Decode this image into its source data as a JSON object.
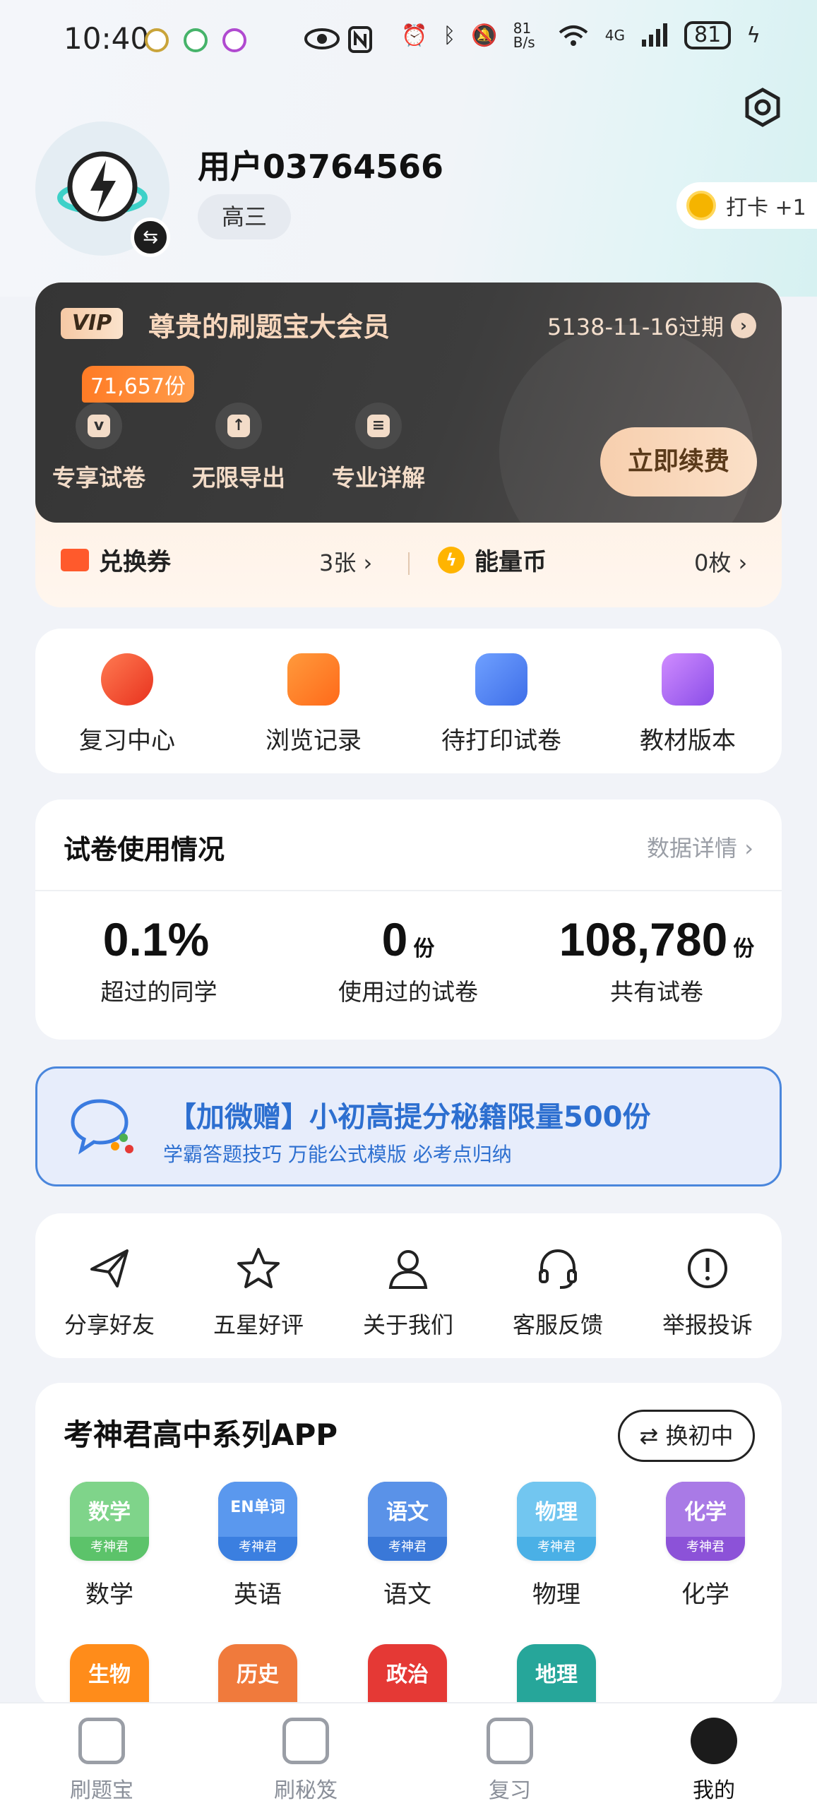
{
  "status_bar": {
    "time": "10:40",
    "net_speed": "81 B/s",
    "network": "4G",
    "battery": "81"
  },
  "profile": {
    "username": "用户03764566",
    "grade": "高三",
    "checkin": "打卡 +1"
  },
  "vip": {
    "badge": "VIP",
    "title": "尊贵的刷题宝大会员",
    "expire": "5138-11-16过期",
    "count": "71,657份",
    "features": [
      "专享试卷",
      "无限导出",
      "专业详解"
    ],
    "renew_button": "立即续费",
    "voucher_label": "兑换券",
    "voucher_value": "3张 ›",
    "coin_label": "能量币",
    "coin_value": "0枚 ›"
  },
  "tools": [
    "复习中心",
    "浏览记录",
    "待打印试卷",
    "教材版本"
  ],
  "usage": {
    "title": "试卷使用情况",
    "link": "数据详情 ›",
    "stats": [
      {
        "value": "0.1%",
        "unit": "",
        "label": "超过的同学"
      },
      {
        "value": "0",
        "unit": "份",
        "label": "使用过的试卷"
      },
      {
        "value": "108,780",
        "unit": "份",
        "label": "共有试卷"
      }
    ]
  },
  "banner": {
    "title": "【加微赠】小初高提分秘籍限量500份",
    "subtitle": "学霸答题技巧 万能公式模版 必考点归纳"
  },
  "misc": [
    "分享好友",
    "五星好评",
    "关于我们",
    "客服反馈",
    "举报投诉"
  ],
  "apps": {
    "title": "考神君高中系列APP",
    "switch_button": "⇄ 换初中",
    "brand": "考神君",
    "items": [
      {
        "label": "数学",
        "icon_text": "数学",
        "color": "#5cc36a"
      },
      {
        "label": "英语",
        "icon_text": "EN单词",
        "color": "#3b7fe0"
      },
      {
        "label": "语文",
        "icon_text": "语文",
        "color": "#3a78d8"
      },
      {
        "label": "物理",
        "icon_text": "物理",
        "color": "#4ab0e6"
      },
      {
        "label": "化学",
        "icon_text": "化学",
        "color": "#8c52d8"
      }
    ],
    "row2": [
      {
        "icon_text": "生物",
        "color": "#ff8c1a"
      },
      {
        "icon_text": "历史",
        "color": "#f07a3c"
      },
      {
        "icon_text": "政治",
        "color": "#e53935"
      },
      {
        "icon_text": "地理",
        "color": "#26a69a"
      }
    ]
  },
  "nav": [
    "刷题宝",
    "刷秘笈",
    "复习",
    "我的"
  ],
  "colors": {
    "accent": "#2d6fd0",
    "vip_gold": "#f7d7bd",
    "orange": "#ff7b25"
  }
}
